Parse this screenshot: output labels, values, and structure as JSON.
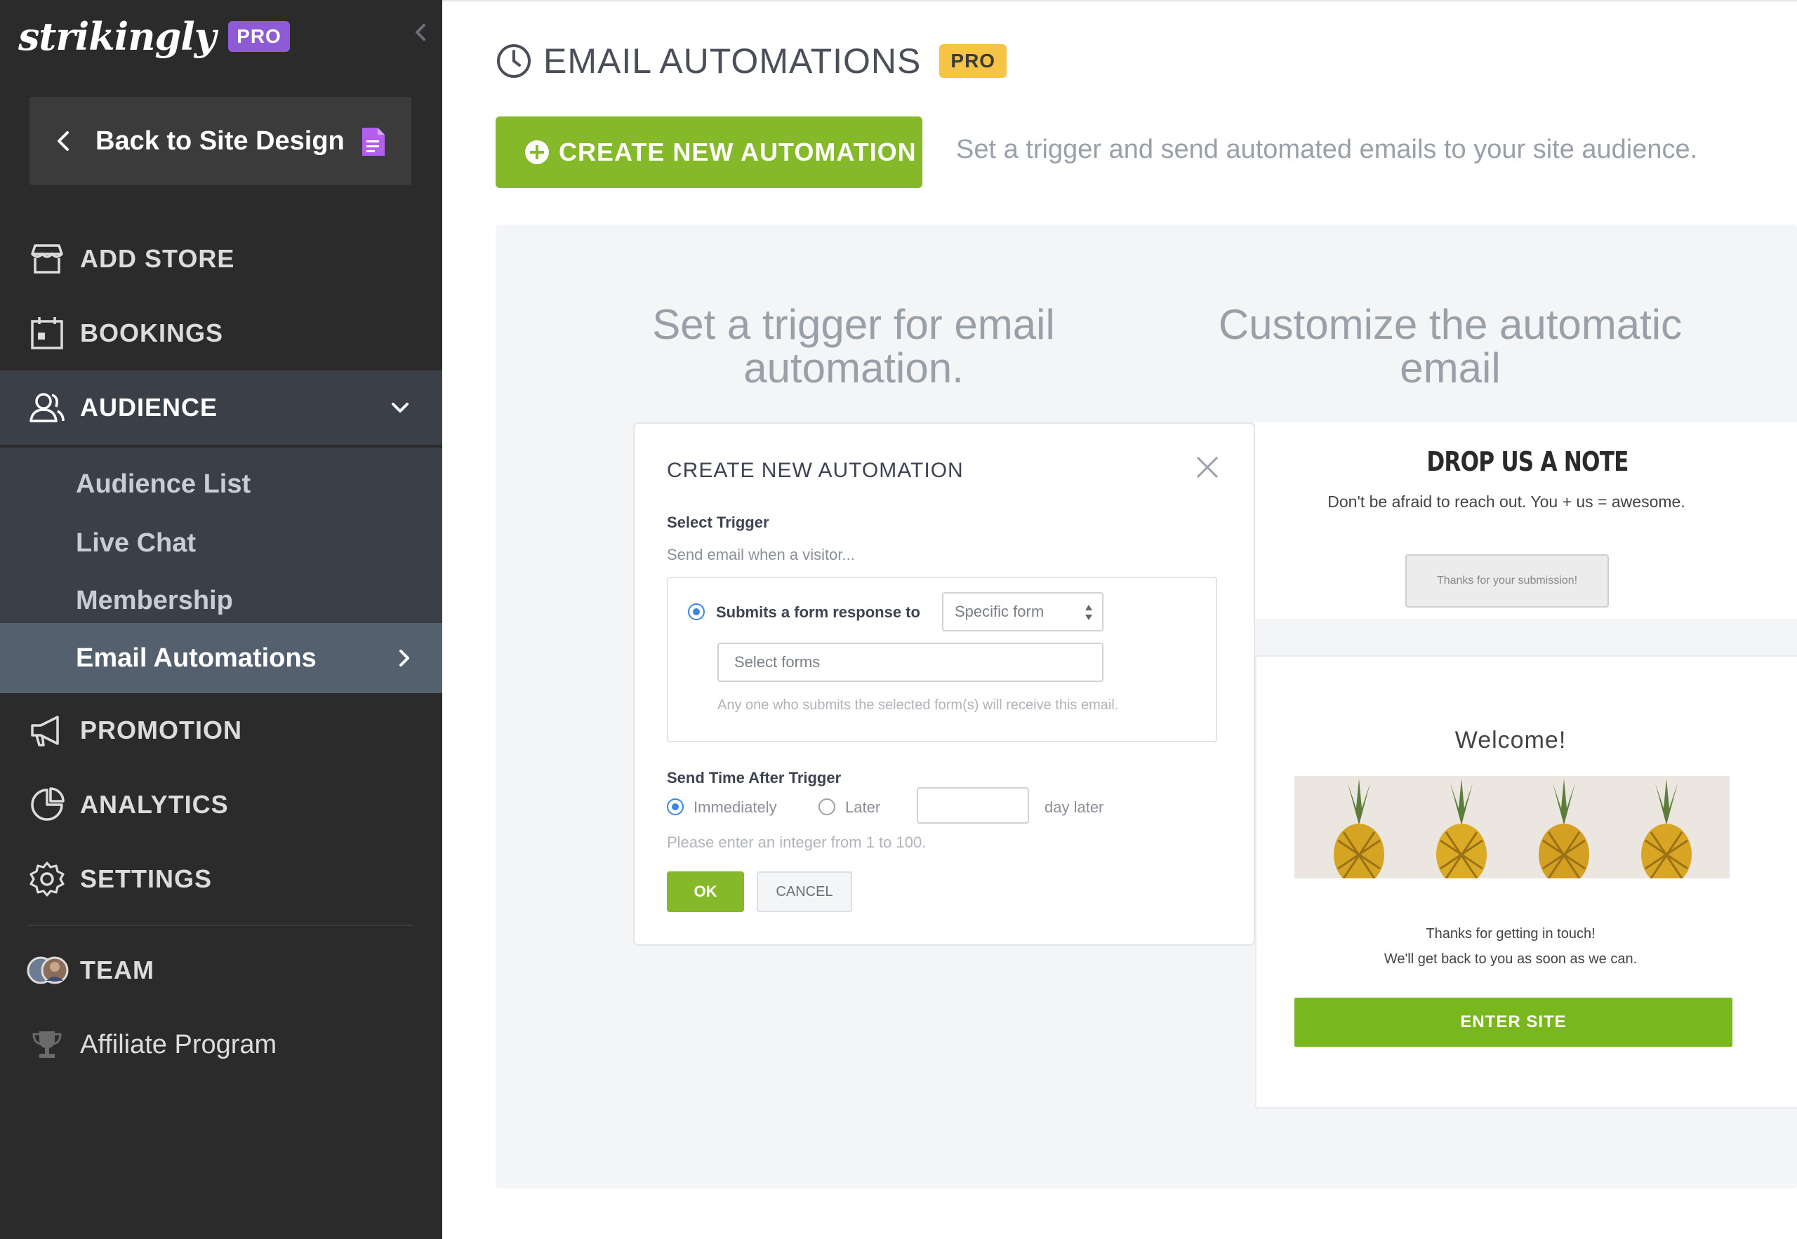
{
  "sidebar": {
    "logo": "strikingly",
    "logo_badge": "PRO",
    "back_button": "Back to Site Design",
    "nav": {
      "add_store": "ADD STORE",
      "bookings": "BOOKINGS",
      "audience": "AUDIENCE",
      "promotion": "PROMOTION",
      "analytics": "ANALYTICS",
      "settings": "SETTINGS",
      "team": "TEAM",
      "affiliate": "Affiliate Program"
    },
    "audience_sub": [
      "Audience List",
      "Live Chat",
      "Membership",
      "Email Automations"
    ]
  },
  "header": {
    "title": "EMAIL AUTOMATIONS",
    "badge": "PRO",
    "create_button": "CREATE NEW AUTOMATION",
    "description": "Set a trigger and send automated emails to your site audience."
  },
  "panel": {
    "left_heading_1": "Set a trigger for email",
    "left_heading_2": "automation.",
    "right_heading_1": "Customize the automatic",
    "right_heading_2": "email"
  },
  "modal": {
    "title": "CREATE NEW AUTOMATION",
    "select_trigger_label": "Select Trigger",
    "select_trigger_sub": "Send email when a visitor...",
    "submits_label": "Submits a form response to",
    "specific_form": "Specific form",
    "select_forms_placeholder": "Select forms",
    "anyone_note": "Any one who submits the selected form(s) will receive this email.",
    "send_time_label": "Send Time After Trigger",
    "immediately": "Immediately",
    "later": "Later",
    "day_later": "day later",
    "integer_hint": "Please enter an integer from 1 to 100.",
    "ok": "OK",
    "cancel": "CANCEL"
  },
  "email_preview": {
    "note_title": "DROP US A NOTE",
    "note_sub": "Don't be afraid to reach out. You + us = awesome.",
    "note_button": "Thanks for your submission!",
    "welcome_title": "Welcome!",
    "thanks_line_1": "Thanks for getting in touch!",
    "thanks_line_2": "We'll get back to you as soon as we can.",
    "enter_button": "ENTER SITE"
  },
  "colors": {
    "sidebar_bg": "#2b2b2b",
    "accent_green": "#86b92a",
    "pro_purple": "#8e5ad6",
    "pro_yellow": "#f6c445"
  }
}
